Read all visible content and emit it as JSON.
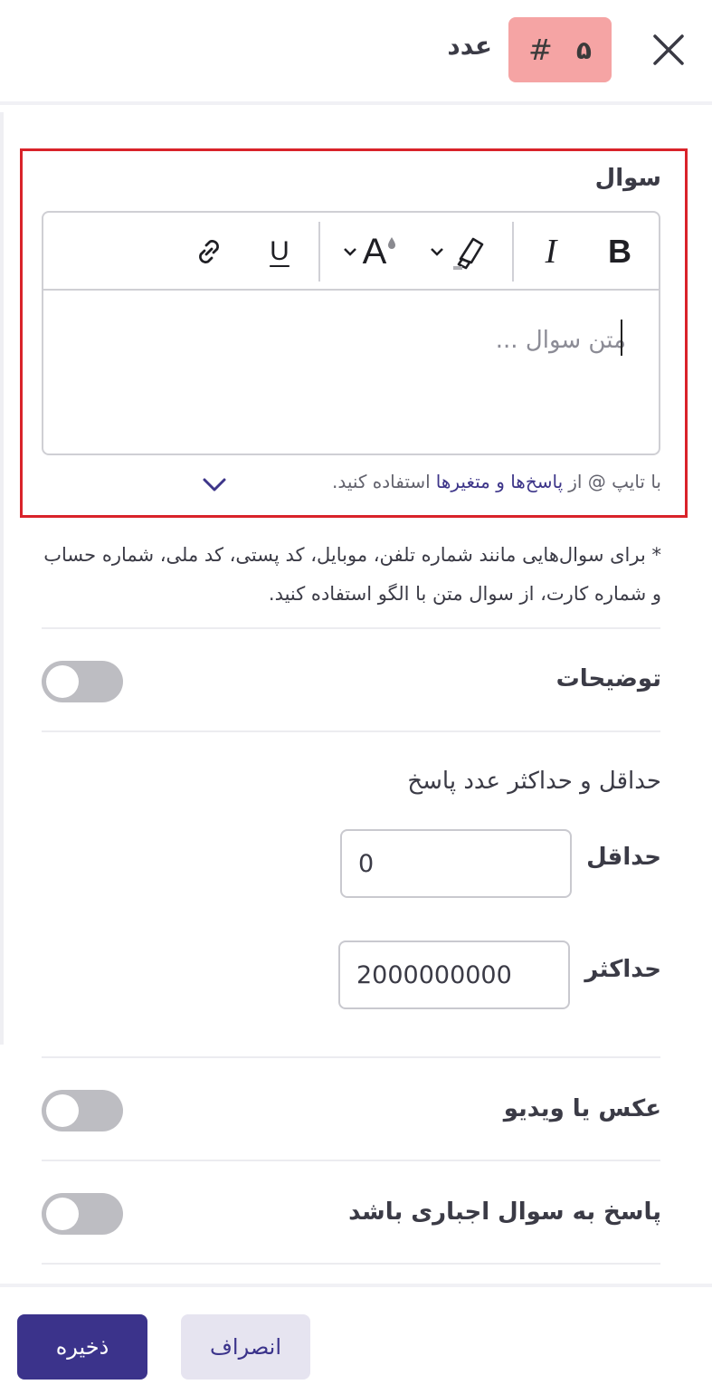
{
  "header": {
    "title": "عدد",
    "badge_number": "۵",
    "badge_symbol": "#",
    "badge_color": "#f5a4a4",
    "close_icon": "close-icon"
  },
  "question": {
    "label": "سوال",
    "placeholder": "متن سوال ...",
    "toolbar": {
      "bold": "B",
      "italic": "I",
      "underline": "U",
      "font_size": "A",
      "highlight_icon": "highlighter-icon",
      "link_icon": "link-icon"
    },
    "hint_prefix": "با تایپ @ از",
    "hint_link": "پاسخ‌ها و متغیرها",
    "hint_suffix": "استفاده کنید.",
    "highlight_border_color": "#d9232a"
  },
  "note": "* برای سوال‌هایی مانند شماره تلفن، موبایل، کد پستی، کد ملی، شماره حساب و شماره کارت، از سوال متن با الگو استفاده کنید.",
  "description": {
    "label": "توضیحات",
    "enabled": false
  },
  "range": {
    "title": "حداقل و حداکثر عدد پاسخ",
    "min_label": "حداقل",
    "min_value": "0",
    "max_label": "حداکثر",
    "max_value": "2000000000"
  },
  "media": {
    "label": "عکس یا ویدیو",
    "enabled": false
  },
  "required": {
    "label": "پاسخ به سوال اجباری باشد",
    "enabled": false
  },
  "footer": {
    "save_label": "ذخیره",
    "cancel_label": "انصراف",
    "primary_color": "#3b338b"
  }
}
